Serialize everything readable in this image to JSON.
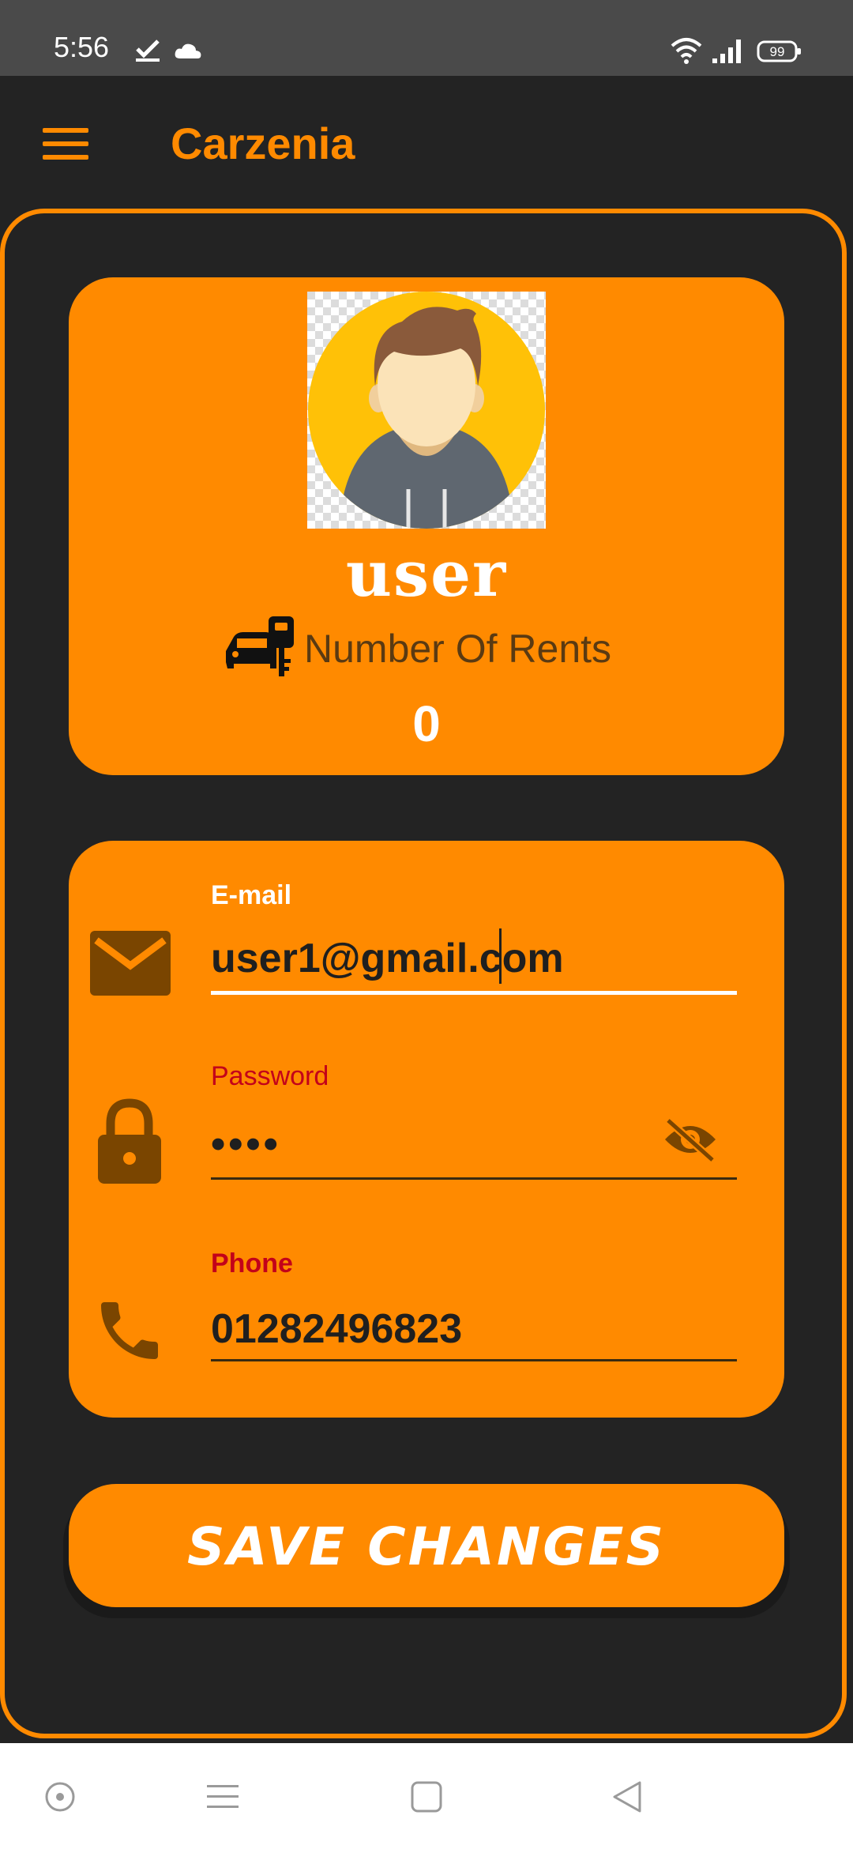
{
  "status_bar": {
    "time": "5:56",
    "battery": "99"
  },
  "app_bar": {
    "title": "Carzenia"
  },
  "profile": {
    "username": "user",
    "rents_label": "Number Of Rents",
    "rents_count": "0"
  },
  "form": {
    "email": {
      "label": "E-mail",
      "value": "user1@gmail.com"
    },
    "password": {
      "label": "Password",
      "value": "••••"
    },
    "phone": {
      "label": "Phone",
      "value": "01282496823"
    }
  },
  "actions": {
    "save_label": "SAVE CHANGES"
  },
  "colors": {
    "accent": "#FF8A00",
    "background": "#232323",
    "status_bar": "#4A4A4A",
    "error_label": "#C3001A",
    "icon_dark": "#7A4500"
  },
  "icons": {
    "status": [
      "check-icon",
      "cloud-icon",
      "wifi-icon",
      "signal-icon",
      "battery-icon"
    ],
    "nav": [
      "circle-home-icon",
      "recents-menu-icon",
      "square-home-icon",
      "back-triangle-icon"
    ]
  }
}
